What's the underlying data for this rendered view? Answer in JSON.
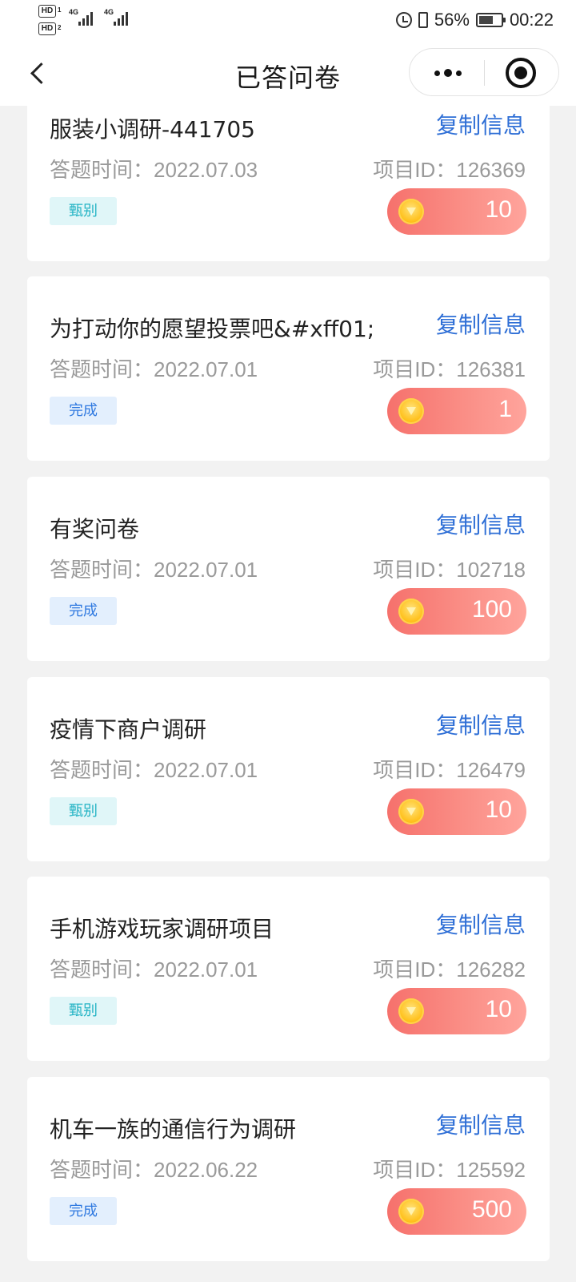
{
  "status_bar": {
    "hd1": "HD",
    "hd2": "HD",
    "hd1_sub": "1",
    "hd2_sub": "2",
    "net1": "4G",
    "net2": "4G",
    "battery_percent": "56%",
    "time": "00:22",
    "icons": [
      "alarm-icon",
      "vibrate-icon",
      "battery-icon"
    ]
  },
  "nav": {
    "title": "已答问卷",
    "back_icon": "chevron-left-icon",
    "more_icon": "more-dots-icon",
    "close_icon": "target-circle-icon"
  },
  "labels": {
    "copy": "复制信息",
    "time_prefix": "答题时间：",
    "id_prefix": "项目ID："
  },
  "colors": {
    "accent_blue": "#2f6fd6",
    "reward_red": "#f6716c",
    "badge_screen": "#22b3c4",
    "badge_done": "#2f79e0"
  },
  "cards": [
    {
      "title": "服装小调研-441705",
      "date": "2022.07.03",
      "project_id": "126369",
      "status": "甄别",
      "status_type": "screen",
      "reward": "10"
    },
    {
      "title": "为打动你的愿望投票吧&#xff01;",
      "date": "2022.07.01",
      "project_id": "126381",
      "status": "完成",
      "status_type": "done",
      "reward": "1"
    },
    {
      "title": "有奖问卷",
      "date": "2022.07.01",
      "project_id": "102718",
      "status": "完成",
      "status_type": "done",
      "reward": "100"
    },
    {
      "title": "疫情下商户调研",
      "date": "2022.07.01",
      "project_id": "126479",
      "status": "甄别",
      "status_type": "screen",
      "reward": "10"
    },
    {
      "title": "手机游戏玩家调研项目",
      "date": "2022.07.01",
      "project_id": "126282",
      "status": "甄别",
      "status_type": "screen",
      "reward": "10"
    },
    {
      "title": "机车一族的通信行为调研",
      "date": "2022.06.22",
      "project_id": "125592",
      "status": "完成",
      "status_type": "done",
      "reward": "500"
    }
  ]
}
